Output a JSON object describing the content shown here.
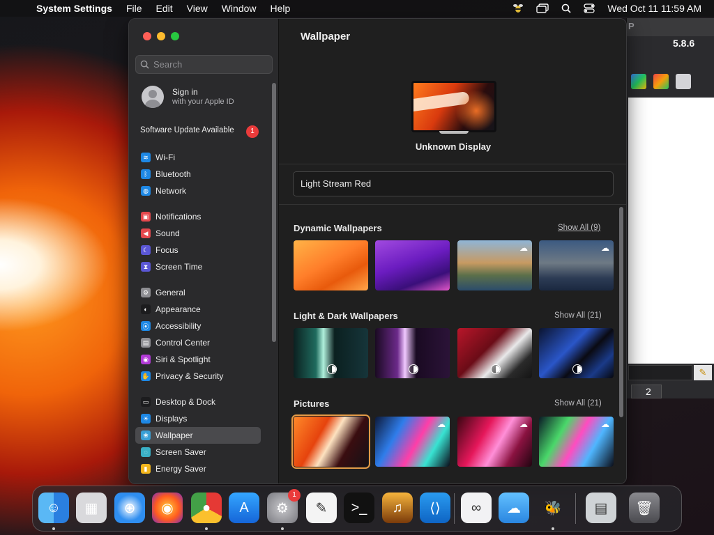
{
  "menubar": {
    "app_name": "System Settings",
    "menus": [
      "File",
      "Edit",
      "View",
      "Window",
      "Help"
    ],
    "datetime": "Wed Oct 11  11:59 AM"
  },
  "background_window": {
    "version": "5.8.6",
    "tab_count": "2"
  },
  "sidebar": {
    "search_placeholder": "Search",
    "apple_id_line1": "Sign in",
    "apple_id_line2": "with your Apple ID",
    "update_label": "Software Update Available",
    "update_badge": "1",
    "items": [
      {
        "label": "Wi-Fi",
        "icon": "wifi-icon",
        "color": "#1e88e5",
        "glyph": "≋"
      },
      {
        "label": "Bluetooth",
        "icon": "bluetooth-icon",
        "color": "#1e88e5",
        "glyph": "ᛒ"
      },
      {
        "label": "Network",
        "icon": "globe-icon",
        "color": "#1e88e5",
        "glyph": "◍"
      },
      {
        "label": "Notifications",
        "icon": "bell-icon",
        "color": "#e5484d",
        "glyph": "▣"
      },
      {
        "label": "Sound",
        "icon": "speaker-icon",
        "color": "#e5484d",
        "glyph": "◀"
      },
      {
        "label": "Focus",
        "icon": "moon-icon",
        "color": "#5b57d6",
        "glyph": "☾"
      },
      {
        "label": "Screen Time",
        "icon": "hourglass-icon",
        "color": "#5b57d6",
        "glyph": "⧗"
      },
      {
        "label": "General",
        "icon": "gear-icon",
        "color": "#8e8e93",
        "glyph": "⚙"
      },
      {
        "label": "Appearance",
        "icon": "appearance-icon",
        "color": "#1c1c1e",
        "glyph": "◐"
      },
      {
        "label": "Accessibility",
        "icon": "accessibility-icon",
        "color": "#1e88e5",
        "glyph": "⦿"
      },
      {
        "label": "Control Center",
        "icon": "control-center-icon",
        "color": "#8e8e93",
        "glyph": "▤"
      },
      {
        "label": "Siri & Spotlight",
        "icon": "siri-icon",
        "color": "#b23ad6",
        "glyph": "◉"
      },
      {
        "label": "Privacy & Security",
        "icon": "hand-icon",
        "color": "#1e88e5",
        "glyph": "✋"
      },
      {
        "label": "Desktop & Dock",
        "icon": "dock-icon",
        "color": "#1c1c1e",
        "glyph": "▭"
      },
      {
        "label": "Displays",
        "icon": "sun-icon",
        "color": "#1e88e5",
        "glyph": "☀"
      },
      {
        "label": "Wallpaper",
        "icon": "flower-icon",
        "color": "#3aa0d6",
        "glyph": "❀"
      },
      {
        "label": "Screen Saver",
        "icon": "screensaver-icon",
        "color": "#3ab0c6",
        "glyph": "◌"
      },
      {
        "label": "Energy Saver",
        "icon": "battery-icon",
        "color": "#f2b51c",
        "glyph": "▮"
      }
    ]
  },
  "content": {
    "title": "Wallpaper",
    "display_name": "Unknown Display",
    "current_wallpaper": "Light Stream Red",
    "sections": [
      {
        "title": "Dynamic Wallpapers",
        "show_all": "Show All (9)"
      },
      {
        "title": "Light & Dark Wallpapers",
        "show_all": "Show All (21)"
      },
      {
        "title": "Pictures",
        "show_all": "Show All (21)"
      }
    ]
  },
  "dock": {
    "apps": [
      "Finder",
      "Launchpad",
      "Safari",
      "Firefox",
      "Chrome",
      "App Store",
      "System Settings",
      "TextEdit",
      "Terminal",
      "GarageBand",
      "Visual Studio Code",
      "Visual Studio",
      "iCloud Weather",
      "Cyberduck",
      "Finder Window",
      "Trash"
    ],
    "settings_badge": "1"
  }
}
